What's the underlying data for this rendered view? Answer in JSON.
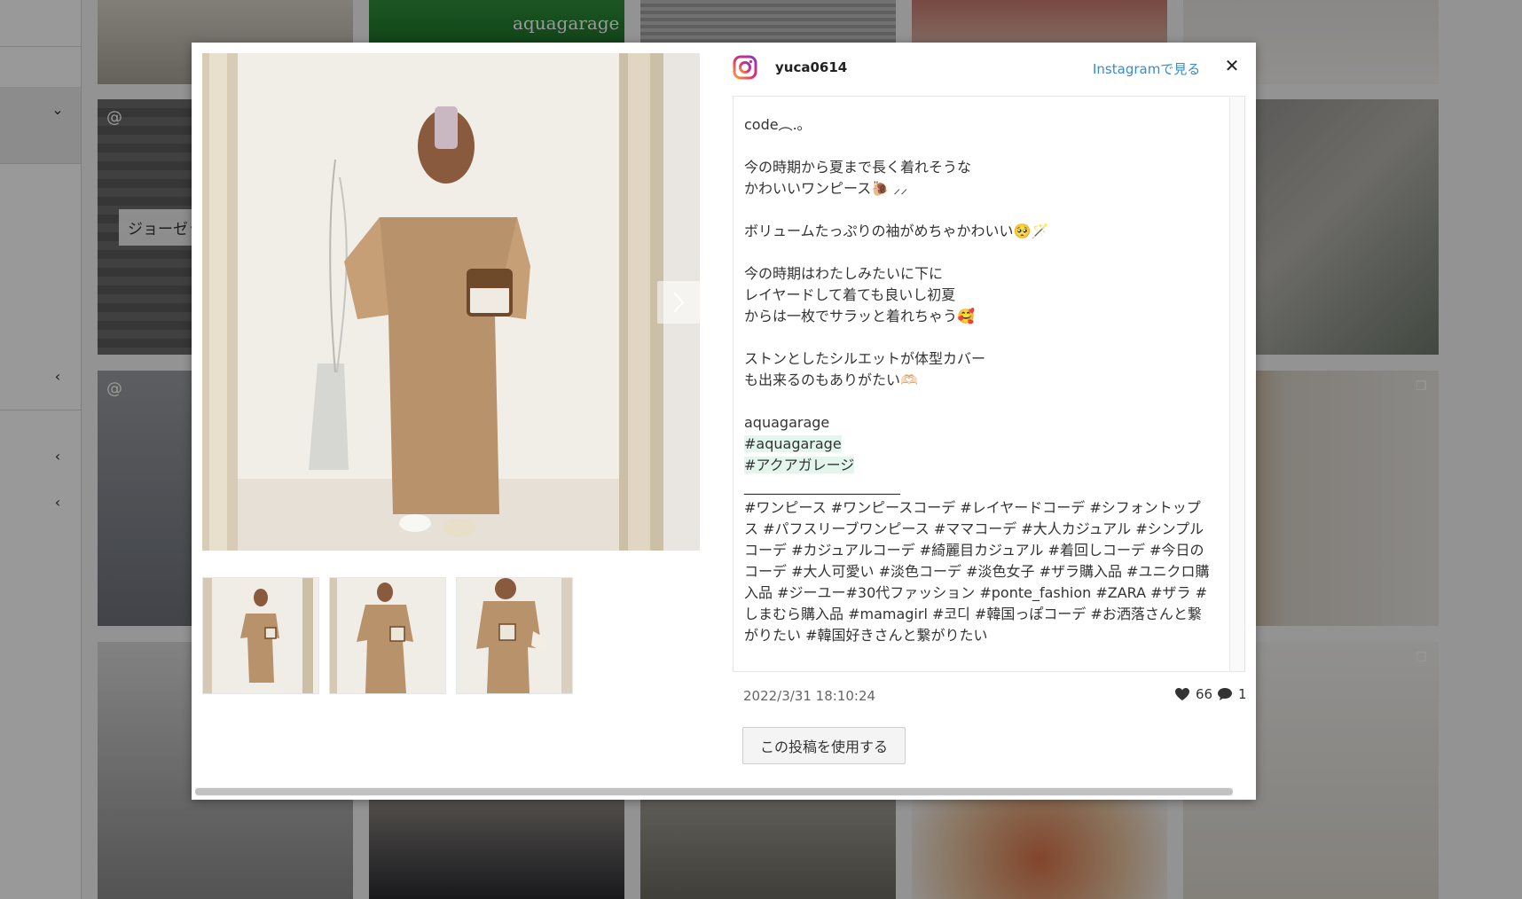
{
  "background": {
    "tile_overlay_text": "aquagarage",
    "chip_text": "ジョーゼッ",
    "at_symbol": "@"
  },
  "modal": {
    "username": "yuca0614",
    "instagram_link": "Instagramで見る",
    "close_symbol": "✕",
    "caption": {
      "line1": "code︵.｡",
      "p1": "今の時期から夏まで長く着れそうな\nかわいいワンピース🐌 ⸝⸝",
      "p2": "ボリュームたっぷりの袖がめちゃかわいい🥺🪄",
      "p3": "今の時期はわたしみたいに下に\nレイヤードして着ても良いし初夏\nからは一枚でサラッと着れちゃう🥰",
      "p4": "ストンとしたシルエットが体型カバー\nも出来るのもありがたい🫶🏻",
      "brand": "aquagarage",
      "tag1": "#aquagarage",
      "tag2": "#アクアガレージ",
      "separator": "______________________",
      "hashtags": "#ワンピース #ワンピースコーデ #レイヤードコーデ #シフォントップス #パフスリーブワンピース #ママコーデ #大人カジュアル #シンプルコーデ #カジュアルコーデ #綺麗目カジュアル #着回しコーデ #今日のコーデ #大人可愛い #淡色コーデ #淡色女子 #ザラ購入品 #ユニクロ購入品 #ジーユー#30代ファッション #ponte_fashion #ZARA #ザラ #しまむら購入品 #mamagirl #코디 #韓国っぽコーデ #お洒落さんと繋がりたい #韓国好きさんと繋がりたい"
    },
    "timestamp": "2022/3/31 18:10:24",
    "likes": "66",
    "comments": "1",
    "use_button": "この投稿を使用する"
  },
  "colors": {
    "link": "#3a8bc7",
    "highlight": "#e2f6ee",
    "overlay": "rgba(0,0,0,0.40)"
  }
}
